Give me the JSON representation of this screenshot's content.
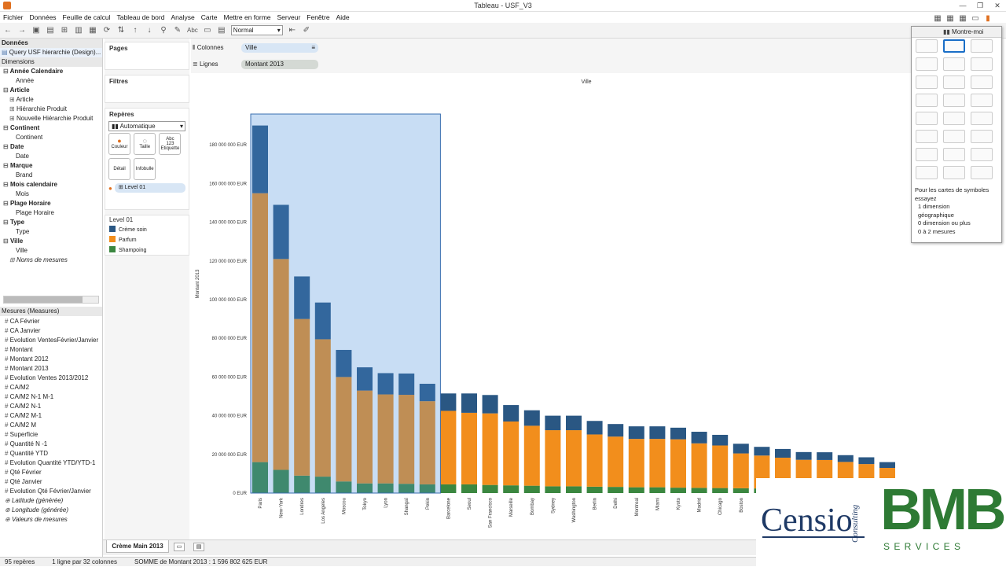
{
  "window": {
    "title": "Tableau - USF_V3"
  },
  "menu": [
    "Fichier",
    "Données",
    "Feuille de calcul",
    "Tableau de bord",
    "Analyse",
    "Carte",
    "Mettre en forme",
    "Serveur",
    "Fenêtre",
    "Aide"
  ],
  "toolbar": {
    "format_value": "Normal",
    "abc_label": "Abc"
  },
  "data_panel": {
    "header": "Données",
    "datasource": "Query USF hierarchie (Design)...",
    "dimensions_header": "Dimensions",
    "dimensions": [
      {
        "label": "Année Calendaire",
        "bold": true,
        "indent": 0
      },
      {
        "label": "Année",
        "bold": false,
        "indent": 2
      },
      {
        "label": "Article",
        "bold": true,
        "indent": 0
      },
      {
        "label": "Article",
        "bold": false,
        "indent": 1
      },
      {
        "label": "Hiérarchie Produit",
        "bold": false,
        "indent": 1
      },
      {
        "label": "Nouvelle Hiérarchie Produit",
        "bold": false,
        "indent": 1
      },
      {
        "label": "Continent",
        "bold": true,
        "indent": 0
      },
      {
        "label": "Continent",
        "bold": false,
        "indent": 2
      },
      {
        "label": "Date",
        "bold": true,
        "indent": 0
      },
      {
        "label": "Date",
        "bold": false,
        "indent": 2
      },
      {
        "label": "Marque",
        "bold": true,
        "indent": 0
      },
      {
        "label": "Brand",
        "bold": false,
        "indent": 2
      },
      {
        "label": "Mois calendaire",
        "bold": true,
        "indent": 0
      },
      {
        "label": "Mois",
        "bold": false,
        "indent": 2
      },
      {
        "label": "Plage Horaire",
        "bold": true,
        "indent": 0
      },
      {
        "label": "Plage Horaire",
        "bold": false,
        "indent": 2
      },
      {
        "label": "Type",
        "bold": true,
        "indent": 0
      },
      {
        "label": "Type",
        "bold": false,
        "indent": 2
      },
      {
        "label": "Ville",
        "bold": true,
        "indent": 0
      },
      {
        "label": "Ville",
        "bold": false,
        "indent": 2
      },
      {
        "label": "Noms de mesures",
        "bold": false,
        "indent": 1,
        "italic": true
      }
    ],
    "measures_header": "Mesures (Measures)",
    "measures": [
      "CA Février",
      "CA Janvier",
      "Evolution VentesFévrier/Janvier",
      "Montant",
      "Montant 2012",
      "Montant 2013",
      "Evolution Ventes 2013/2012",
      "CA/M2",
      "CA/M2 N-1 M-1",
      "CA/M2 N-1",
      "CA/M2 M-1",
      "CA/M2 M",
      "Superficie",
      "Quantité N -1",
      "Quantité YTD",
      "Evolution Quantité YTD/YTD-1",
      "Qté Février",
      "Qté Janvier",
      "Evolution Qté Février/Janvier",
      "Latitude (générée)",
      "Longitude (générée)",
      "Valeurs de mesures"
    ]
  },
  "cards": {
    "pages": "Pages",
    "filtres": "Filtres",
    "reperes": "Repères",
    "mark_type": "Automatique",
    "btn_couleur": "Couleur",
    "btn_taille": "Taille",
    "btn_etiquette": "Etiquette",
    "btn_detail": "Détail",
    "btn_infobulle": "Infobulle",
    "color_pill": "Level 01",
    "legend_title": "Level 01",
    "legend": [
      {
        "label": "Crème soin",
        "color": "#2a5783"
      },
      {
        "label": "Parfum",
        "color": "#f28e1c"
      },
      {
        "label": "Shampoing",
        "color": "#3b8740"
      }
    ]
  },
  "shelves": {
    "colonnes_label": "Colonnes",
    "colonnes_pill": "Ville",
    "lignes_label": "Lignes",
    "lignes_pill": "Montant 2013"
  },
  "chart_data": {
    "type": "bar",
    "title": "Ville",
    "ylabel": "Montant 2013",
    "ylim": [
      0,
      200000000
    ],
    "yticks": [
      "0 EUR",
      "20 000 000 EUR",
      "40 000 000 EUR",
      "60 000 000 EUR",
      "80 000 000 EUR",
      "100 000 000 EUR",
      "120 000 000 EUR",
      "140 000 000 EUR",
      "160 000 000 EUR",
      "180 000 000 EUR"
    ],
    "ytick_values": [
      0,
      20000000,
      40000000,
      60000000,
      80000000,
      100000000,
      120000000,
      140000000,
      160000000,
      180000000
    ],
    "categories": [
      "Paris",
      "New-York",
      "Londres",
      "Los Angeles",
      "Moscou",
      "Tokyo",
      "Lyon",
      "Shangaï",
      "Pekin",
      "Barcelone",
      "Seoul",
      "San Francisco",
      "Marseille",
      "Bombay",
      "Sydney",
      "Washington",
      "Berlin",
      "Delhi",
      "Montreal",
      "Miami",
      "Kyoto",
      "Madrid",
      "Chicago",
      "Boston",
      "",
      "",
      "",
      "",
      "",
      "",
      ""
    ],
    "series": [
      {
        "name": "Shampoing",
        "color": "#3b8740",
        "values": [
          16000000,
          12000000,
          9000000,
          8500000,
          6000000,
          5000000,
          5000000,
          4800000,
          4500000,
          4500000,
          4500000,
          4200000,
          4000000,
          3800000,
          3500000,
          3500000,
          3300000,
          3200000,
          3000000,
          3000000,
          2800000,
          2700000,
          2600000,
          2500000,
          2400000,
          2300000,
          2200000,
          2100000,
          2100000,
          2000000,
          2000000
        ]
      },
      {
        "name": "Parfum",
        "color": "#f28e1c",
        "values": [
          139000000,
          109000000,
          81000000,
          71000000,
          54000000,
          48000000,
          46000000,
          46000000,
          43000000,
          38000000,
          37000000,
          37000000,
          33000000,
          31000000,
          29000000,
          29000000,
          27000000,
          26000000,
          25000000,
          25000000,
          25000000,
          23000000,
          22000000,
          18000000,
          17000000,
          16000000,
          15000000,
          15000000,
          14000000,
          13000000,
          11000000
        ]
      },
      {
        "name": "Crème soin",
        "color": "#2a5783",
        "values": [
          35000000,
          28000000,
          22000000,
          19000000,
          14000000,
          12000000,
          11000000,
          11000000,
          9000000,
          9000000,
          10000000,
          9500000,
          8500000,
          8000000,
          7500000,
          7500000,
          7000000,
          6500000,
          6500000,
          6500000,
          6000000,
          6000000,
          5500000,
          5000000,
          4500000,
          4500000,
          4000000,
          4000000,
          3500000,
          3500000,
          3000000
        ]
      }
    ],
    "selected_count": 9
  },
  "showme": {
    "title": "Montre-moi",
    "hint_title": "Pour les cartes de symboles",
    "hint_sub": "essayez",
    "hint_lines": [
      "1 dimension",
      "géographique",
      "0 dimension ou plus",
      "0 à 2 mesures"
    ]
  },
  "sheet_tab": "Crème Main 2013",
  "status": {
    "marks": "95 repères",
    "rows": "1 ligne par 32 colonnes",
    "sum": "SOMME de Montant 2013 : 1 596 802 625 EUR"
  },
  "logos": {
    "censio": "Censio",
    "consulting": "Consulting",
    "bmb": "BMB",
    "services": "S E R V I C E S"
  }
}
